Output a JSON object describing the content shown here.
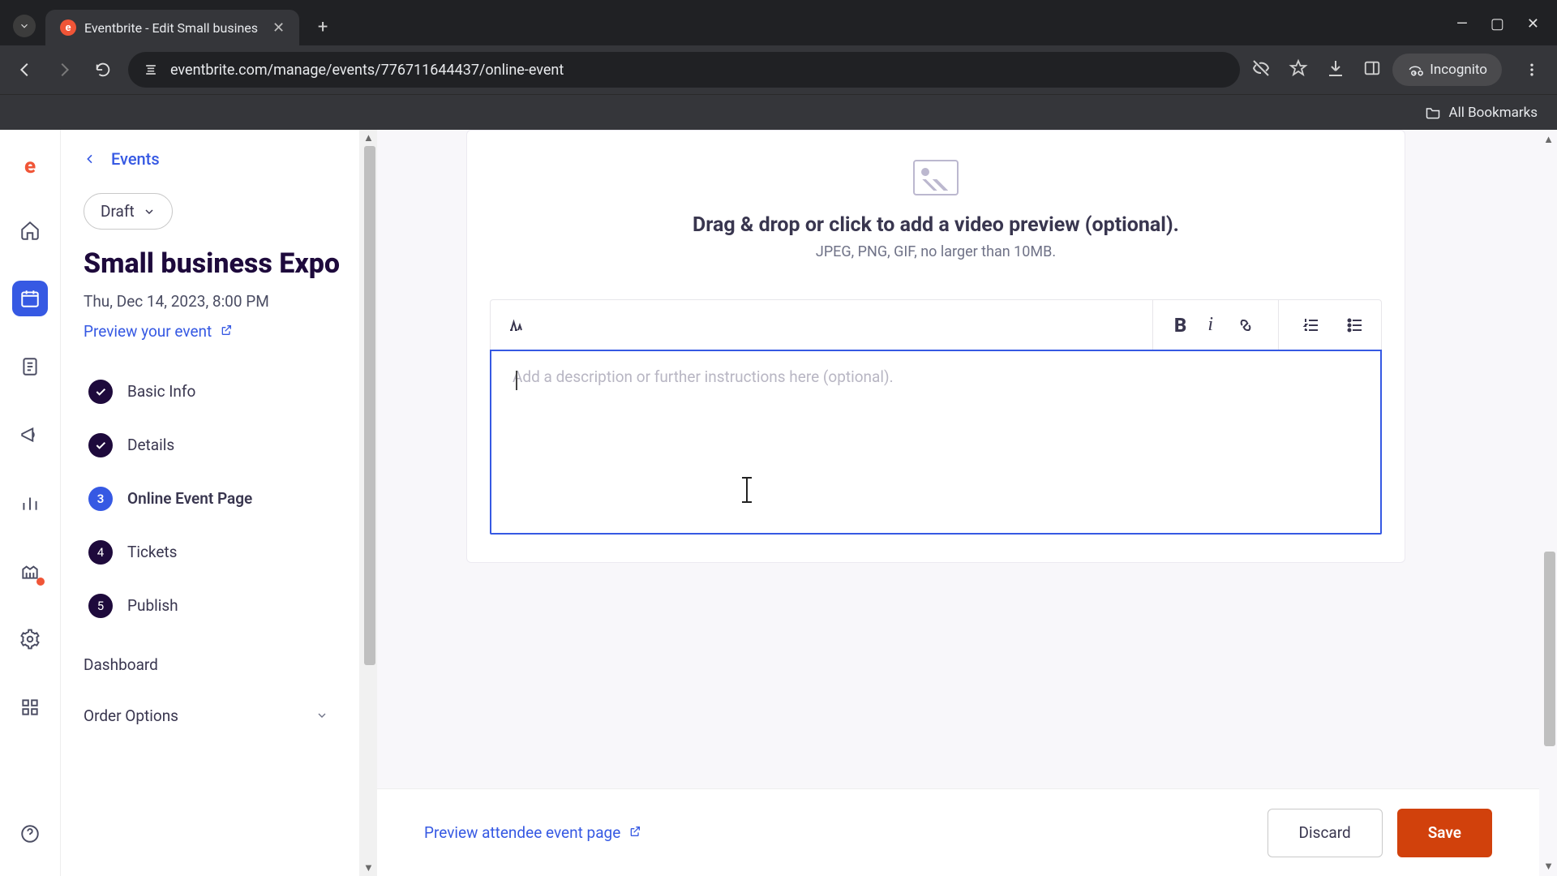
{
  "browser": {
    "tab_title": "Eventbrite - Edit Small busines",
    "url": "eventbrite.com/manage/events/776711644437/online-event",
    "incognito_label": "Incognito",
    "all_bookmarks": "All Bookmarks"
  },
  "sidebar": {
    "back_label": "Events",
    "status_pill": "Draft",
    "event_title": "Small business Expo",
    "event_datetime": "Thu, Dec 14, 2023, 8:00 PM",
    "preview_link": "Preview your event",
    "steps": [
      {
        "label": "Basic Info",
        "state": "done"
      },
      {
        "label": "Details",
        "state": "done"
      },
      {
        "label": "Online Event Page",
        "state": "active",
        "num": "3"
      },
      {
        "label": "Tickets",
        "state": "todo",
        "num": "4"
      },
      {
        "label": "Publish",
        "state": "todo",
        "num": "5"
      }
    ],
    "links": {
      "dashboard": "Dashboard",
      "order_options": "Order Options"
    }
  },
  "main": {
    "dropzone_title": "Drag & drop or click to add a video preview (optional).",
    "dropzone_sub": "JPEG, PNG, GIF, no larger than 10MB.",
    "editor_placeholder": "Add a description or further instructions here (optional)."
  },
  "footer": {
    "preview_label": "Preview attendee event page",
    "discard": "Discard",
    "save": "Save"
  }
}
